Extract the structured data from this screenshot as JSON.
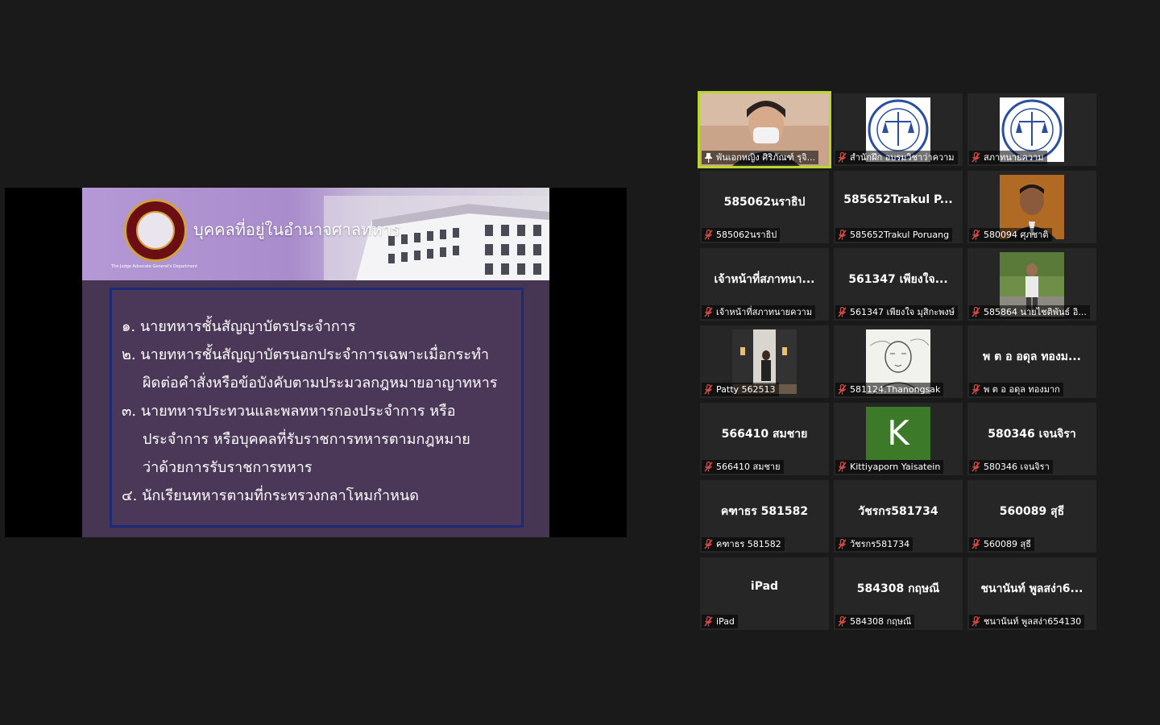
{
  "slide": {
    "title": "บุคคลที่อยู่ในอำนาจศาลทหาร",
    "subtitle": "The Judge Advocate General's Department",
    "lines": [
      "๑. นายทหารชั้นสัญญาบัตรประจำการ",
      "๒. นายทหารชั้นสัญญาบัตรนอกประจำการเฉพาะเมื่อกระทำ",
      "ผิดต่อคำสั่งหรือข้อบังคับตามประมวลกฎหมายอาญาทหาร",
      "๓. นายทหารประทวนและพลทหารกองประจำการ หรือ",
      "ประจำการ หรือบุคคลที่รับราชการทหารตามกฎหมาย",
      "ว่าด้วยการรับราชการทหาร",
      "๔. นักเรียนทหารตามที่กระทรวงกลาโหมกำหนด"
    ]
  },
  "participants": [
    {
      "center": "",
      "label": "พันเอกหญิง ศิริภัณฑ์ รุจิ...",
      "media": "video-woman",
      "pinned": true
    },
    {
      "center": "",
      "label": "สำนักฝึก อบรมวิชาว่าความ",
      "media": "logo"
    },
    {
      "center": "",
      "label": "สภาทนายความ",
      "media": "logo"
    },
    {
      "center": "585062นราธิป",
      "label": "585062นราธิป",
      "media": "none"
    },
    {
      "center": "585652Trakul P...",
      "label": "585652Trakul Poruang",
      "media": "none"
    },
    {
      "center": "",
      "label": "580094 ศุภชาติ",
      "media": "photo-man"
    },
    {
      "center": "เจ้าหน้าที่สภาทนา...",
      "label": "เจ้าหน้าที่สภาทนายความ",
      "media": "none"
    },
    {
      "center": "561347 เพียงใจ...",
      "label": "561347 เพียงใจ มุสิกะพงษ์",
      "media": "none"
    },
    {
      "center": "",
      "label": "585864 นายไชติพันธ์ อิ...",
      "media": "photo-outdoor"
    },
    {
      "center": "",
      "label": "Patty 562513",
      "media": "photo-room"
    },
    {
      "center": "",
      "label": "581124.Thanongsak",
      "media": "photo-sketch"
    },
    {
      "center": "พ ต อ อดุล ทองม...",
      "label": "พ ต อ อดุล ทองมาก",
      "media": "none"
    },
    {
      "center": "566410 สมชาย",
      "label": "566410 สมชาย",
      "media": "none"
    },
    {
      "center": "",
      "label": "Kittiyaporn Yaisatein",
      "media": "avatar",
      "avatar_letter": "K"
    },
    {
      "center": "580346 เจนจิรา",
      "label": "580346 เจนจิรา",
      "media": "none"
    },
    {
      "center": "คฑาธร 581582",
      "label": "คฑาธร 581582",
      "media": "none"
    },
    {
      "center": "วัชรกร581734",
      "label": "วัชรกร581734",
      "media": "none"
    },
    {
      "center": "560089 สุธี",
      "label": "560089 สุธี",
      "media": "none"
    },
    {
      "center": "iPad",
      "label": "iPad",
      "media": "none"
    },
    {
      "center": "584308 กฤษณี",
      "label": "584308 กฤษณี",
      "media": "none"
    },
    {
      "center": "ชนานันท์ พูลสง่า6...",
      "label": "ชนานันท์ พูลสง่า654130",
      "media": "none"
    }
  ],
  "colors": {
    "active_speaker_border": "#b8d72f",
    "muted_icon": "#e0443e",
    "tile_bg": "#262626",
    "page_bg": "#1a1a1a"
  }
}
